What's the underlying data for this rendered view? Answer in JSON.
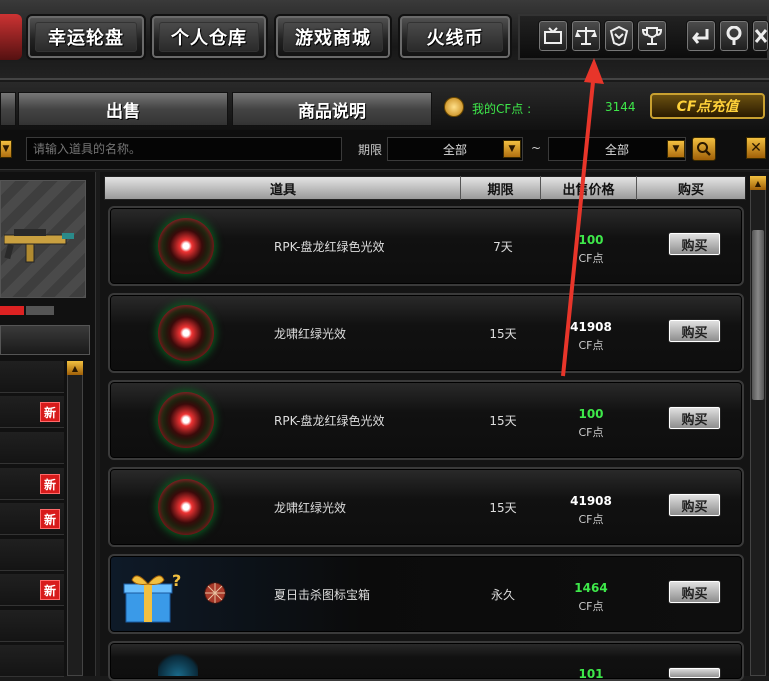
{
  "top_nav": {
    "lucky_wheel": "幸运轮盘",
    "personal_storage": "个人仓库",
    "game_mall": "游戏商城",
    "firecoin": "火线币"
  },
  "top_icons": [
    "tv-icon",
    "scale-icon",
    "shield-icon",
    "trophy-icon",
    "back-icon",
    "help-icon",
    "close-icon"
  ],
  "tabs": {
    "sell": "出售",
    "item_desc": "商品说明"
  },
  "account": {
    "cf_label": "我的CF点 :",
    "cf_value": "3144",
    "recharge": "CF点充值"
  },
  "search": {
    "placeholder": "请输入道具的名称。",
    "period_label": "期限",
    "period_from": "全部",
    "tilde": "~",
    "period_to": "全部"
  },
  "left_panel": {
    "new_badge": "新",
    "new_rows": [
      1,
      3,
      4,
      6
    ]
  },
  "table": {
    "headers": {
      "item": "道具",
      "period": "期限",
      "price": "出售价格",
      "buy": "购买"
    },
    "rows": [
      {
        "name": "RPK-盘龙红绿色光效",
        "period": "7天",
        "price": "100",
        "price_color": "#3ee84a",
        "unit": "CF点",
        "buy": "购买"
      },
      {
        "name": "龙啸红绿光效",
        "period": "15天",
        "price": "41908",
        "price_color": "#ffffff",
        "unit": "CF点",
        "buy": "购买"
      },
      {
        "name": "RPK-盘龙红绿色光效",
        "period": "15天",
        "price": "100",
        "price_color": "#3ee84a",
        "unit": "CF点",
        "buy": "购买"
      },
      {
        "name": "龙啸红绿光效",
        "period": "15天",
        "price": "41908",
        "price_color": "#ffffff",
        "unit": "CF点",
        "buy": "购买"
      },
      {
        "name": "夏日击杀图标宝箱",
        "period": "永久",
        "price": "1464",
        "price_color": "#3ee84a",
        "unit": "CF点",
        "buy": "购买"
      },
      {
        "name": "",
        "period": "",
        "price": "101",
        "price_color": "#3ee84a",
        "unit": "",
        "buy": "购买"
      }
    ]
  },
  "colors": {
    "accent_green": "#3ee84a",
    "accent_gold": "#ffd23a",
    "new_red": "#d81b1b",
    "arrow_red": "#e8352a"
  }
}
